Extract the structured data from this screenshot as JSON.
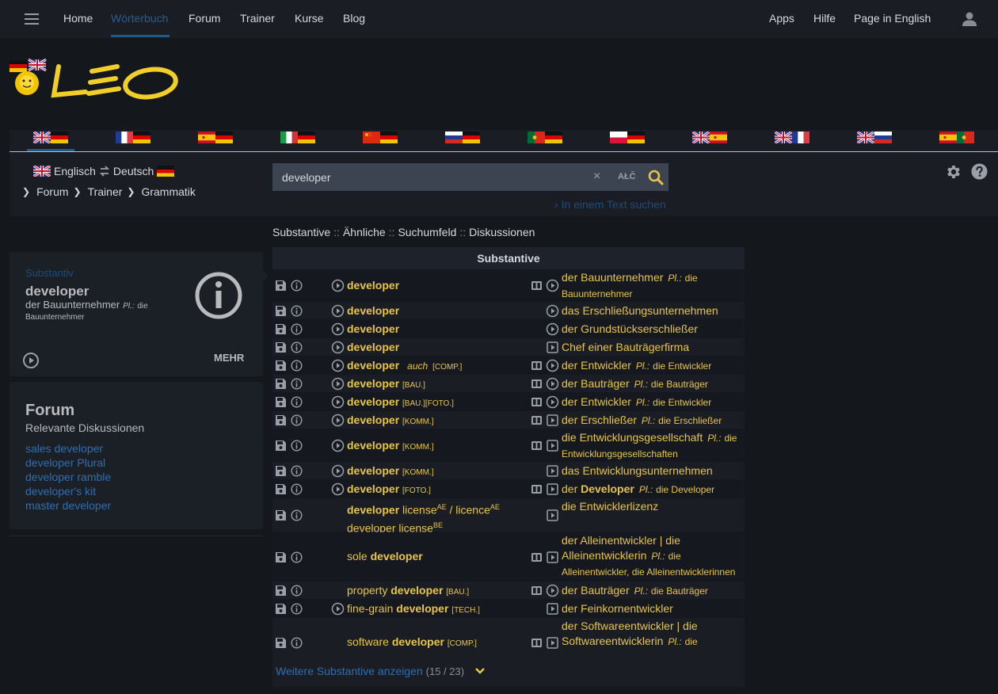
{
  "nav": {
    "items": [
      {
        "label": "Home",
        "active": false
      },
      {
        "label": "Wörterbuch",
        "active": true
      },
      {
        "label": "Forum",
        "active": false
      },
      {
        "label": "Trainer",
        "active": false
      },
      {
        "label": "Kurse",
        "active": false
      },
      {
        "label": "Blog",
        "active": false
      }
    ],
    "right": [
      {
        "label": "Apps"
      },
      {
        "label": "Hilfe"
      },
      {
        "label": "Page in English"
      }
    ]
  },
  "logo": {
    "text": "LEO"
  },
  "language_pairs": [
    {
      "pair": "en-de",
      "active": true
    },
    {
      "pair": "fr-de",
      "active": false
    },
    {
      "pair": "es-de",
      "active": false
    },
    {
      "pair": "it-de",
      "active": false
    },
    {
      "pair": "zh-de",
      "active": false
    },
    {
      "pair": "ru-de",
      "active": false
    },
    {
      "pair": "pt-de",
      "active": false
    },
    {
      "pair": "pl-de",
      "active": false
    },
    {
      "pair": "en-es",
      "active": false
    },
    {
      "pair": "en-fr",
      "active": false
    },
    {
      "pair": "en-ru",
      "active": false
    },
    {
      "pair": "es-pt",
      "active": false
    }
  ],
  "lang_selector": {
    "left": "Englisch",
    "right": "Deutsch",
    "swap_icon": "swap-arrows-icon"
  },
  "breadcrumbs": [
    "Forum",
    "Trainer",
    "Grammatik"
  ],
  "search": {
    "value": "developer",
    "clear_label": "×",
    "special_chars_label": "AŁČ",
    "text_search_link": "In einem Text suchen"
  },
  "section_links": [
    "Substantive",
    "Ähnliche",
    "Suchumfeld",
    "Diskussionen"
  ],
  "section_separator": "::",
  "info_card": {
    "type": "Substantiv",
    "word": "developer",
    "translation": "der Bauunternehmer",
    "plural_label": "Pl.:",
    "plural_value_1": "die",
    "plural_value_2": "Bauunternehmer",
    "more_label": "MEHR"
  },
  "forum": {
    "title": "Forum",
    "subtitle": "Relevante Diskussionen",
    "links": [
      "sales developer",
      "developer Plural",
      "developer ramble",
      "developer's kit",
      "master developer"
    ]
  },
  "results": {
    "header": "Substantive",
    "rows": [
      {
        "en_play": true,
        "en_pre": "",
        "en_bold": "developer",
        "en_post": "",
        "en_tag": "",
        "en_auch": "",
        "flex": true,
        "de_play": "circle",
        "de": "der Bauunternehmer",
        "de_bold": "",
        "pl_label": "Pl.:",
        "pl": "die Bauunternehmer",
        "lines": 2
      },
      {
        "en_play": true,
        "en_pre": "",
        "en_bold": "developer",
        "en_post": "",
        "en_tag": "",
        "en_auch": "",
        "flex": false,
        "de_play": "circle",
        "de": "das Erschließungsunternehmen",
        "de_bold": "",
        "pl_label": "",
        "pl": "",
        "lines": 1
      },
      {
        "en_play": true,
        "en_pre": "",
        "en_bold": "developer",
        "en_post": "",
        "en_tag": "",
        "en_auch": "",
        "flex": false,
        "de_play": "circle",
        "de": "der Grundstückserschließer",
        "de_bold": "",
        "pl_label": "",
        "pl": "",
        "lines": 1
      },
      {
        "en_play": true,
        "en_pre": "",
        "en_bold": "developer",
        "en_post": "",
        "en_tag": "",
        "en_auch": "",
        "flex": false,
        "de_play": "square",
        "de": "Chef einer Bauträgerfirma",
        "de_bold": "",
        "pl_label": "",
        "pl": "",
        "lines": 1
      },
      {
        "en_play": true,
        "en_pre": "",
        "en_bold": "developer",
        "en_post": "",
        "en_tag": "[COMP.]",
        "en_auch": "auch",
        "flex": true,
        "de_play": "circle",
        "de": "der Entwickler",
        "de_bold": "",
        "pl_label": "Pl.:",
        "pl": "die Entwickler",
        "lines": 1
      },
      {
        "en_play": true,
        "en_pre": "",
        "en_bold": "developer",
        "en_post": "",
        "en_tag": "[BAU.]",
        "en_auch": "",
        "flex": true,
        "de_play": "circle",
        "de": "der Bauträger",
        "de_bold": "",
        "pl_label": "Pl.:",
        "pl": "die Bauträger",
        "lines": 1
      },
      {
        "en_play": true,
        "en_pre": "",
        "en_bold": "developer",
        "en_post": "",
        "en_tag": "[BAU.][FOTO.]",
        "en_auch": "",
        "flex": true,
        "de_play": "circle",
        "de": "der Entwickler",
        "de_bold": "",
        "pl_label": "Pl.:",
        "pl": "die Entwickler",
        "lines": 1
      },
      {
        "en_play": true,
        "en_pre": "",
        "en_bold": "developer",
        "en_post": "",
        "en_tag": "[KOMM.]",
        "en_auch": "",
        "flex": true,
        "de_play": "square",
        "de": "der Erschließer",
        "de_bold": "",
        "pl_label": "Pl.:",
        "pl": "die Erschließer",
        "lines": 1
      },
      {
        "en_play": true,
        "en_pre": "",
        "en_bold": "developer",
        "en_post": "",
        "en_tag": "[KOMM.]",
        "en_auch": "",
        "flex": true,
        "de_play": "square",
        "de": "die Entwicklungsgesellschaft",
        "de_bold": "",
        "pl_label": "Pl.:",
        "pl": "die Entwicklungsgesellschaften",
        "lines": 2
      },
      {
        "en_play": true,
        "en_pre": "",
        "en_bold": "developer",
        "en_post": "",
        "en_tag": "[KOMM.]",
        "en_auch": "",
        "flex": false,
        "de_play": "square",
        "de": "das Entwicklungsunternehmen",
        "de_bold": "",
        "pl_label": "",
        "pl": "",
        "lines": 1
      },
      {
        "en_play": true,
        "en_pre": "",
        "en_bold": "developer",
        "en_post": "",
        "en_tag": "[FOTO.]",
        "en_auch": "",
        "flex": true,
        "de_play": "square",
        "de": "der ",
        "de_bold": "Developer",
        "pl_label": "Pl.:",
        "pl": "die Developer",
        "lines": 1
      },
      {
        "en_play": false,
        "en_pre": "",
        "en_bold": "developer",
        "en_post": " license",
        "en_sup1": "AE",
        "en_mid": " / licence",
        "en_sup2": "AE",
        "en_line2": "developer license",
        "en_sup3": "BE",
        "en_tag": "",
        "en_auch": "",
        "flex": false,
        "de_play": "square",
        "de": "die Entwicklerlizenz",
        "de_bold": "",
        "pl_label": "",
        "pl": "",
        "lines": 2
      },
      {
        "en_play": false,
        "en_pre": "sole ",
        "en_bold": "developer",
        "en_post": "",
        "en_tag": "",
        "en_auch": "",
        "flex": true,
        "de_play": "square",
        "de": "der Alleinentwickler | die Alleinentwicklerin",
        "de_bold": "",
        "pl_label": "Pl.:",
        "pl": "die Alleinentwickler, die Alleinentwicklerinnen",
        "lines": 3
      },
      {
        "en_play": false,
        "en_pre": "property ",
        "en_bold": "developer",
        "en_post": "",
        "en_tag": "[BAU.]",
        "en_auch": "",
        "flex": true,
        "de_play": "circle",
        "de": "der Bauträger",
        "de_bold": "",
        "pl_label": "Pl.:",
        "pl": "die Bauträger",
        "lines": 1
      },
      {
        "en_play": true,
        "en_pre": "fine-grain ",
        "en_bold": "developer",
        "en_post": "",
        "en_tag": "[TECH.]",
        "en_auch": "",
        "flex": false,
        "de_play": "square",
        "de": "der Feinkornentwickler",
        "de_bold": "",
        "pl_label": "",
        "pl": "",
        "lines": 1
      },
      {
        "en_play": false,
        "en_pre": "software ",
        "en_bold": "developer",
        "en_post": "",
        "en_tag": "[COMP.]",
        "en_auch": "",
        "flex": true,
        "de_play": "square",
        "de": "der Softwareentwickler | die Softwareentwicklerin",
        "de_bold": "",
        "pl_label": "Pl.:",
        "pl": "die",
        "lines": 3
      }
    ],
    "more_label": "Weitere Substantive anzeigen",
    "more_count": "(15 / 23)"
  },
  "colors": {
    "accent_yellow": "#e8c547",
    "link_blue": "#2f6fb0",
    "active_blue": "#1f5b8a",
    "background": "#14171c",
    "panel": "#1a1d24"
  }
}
